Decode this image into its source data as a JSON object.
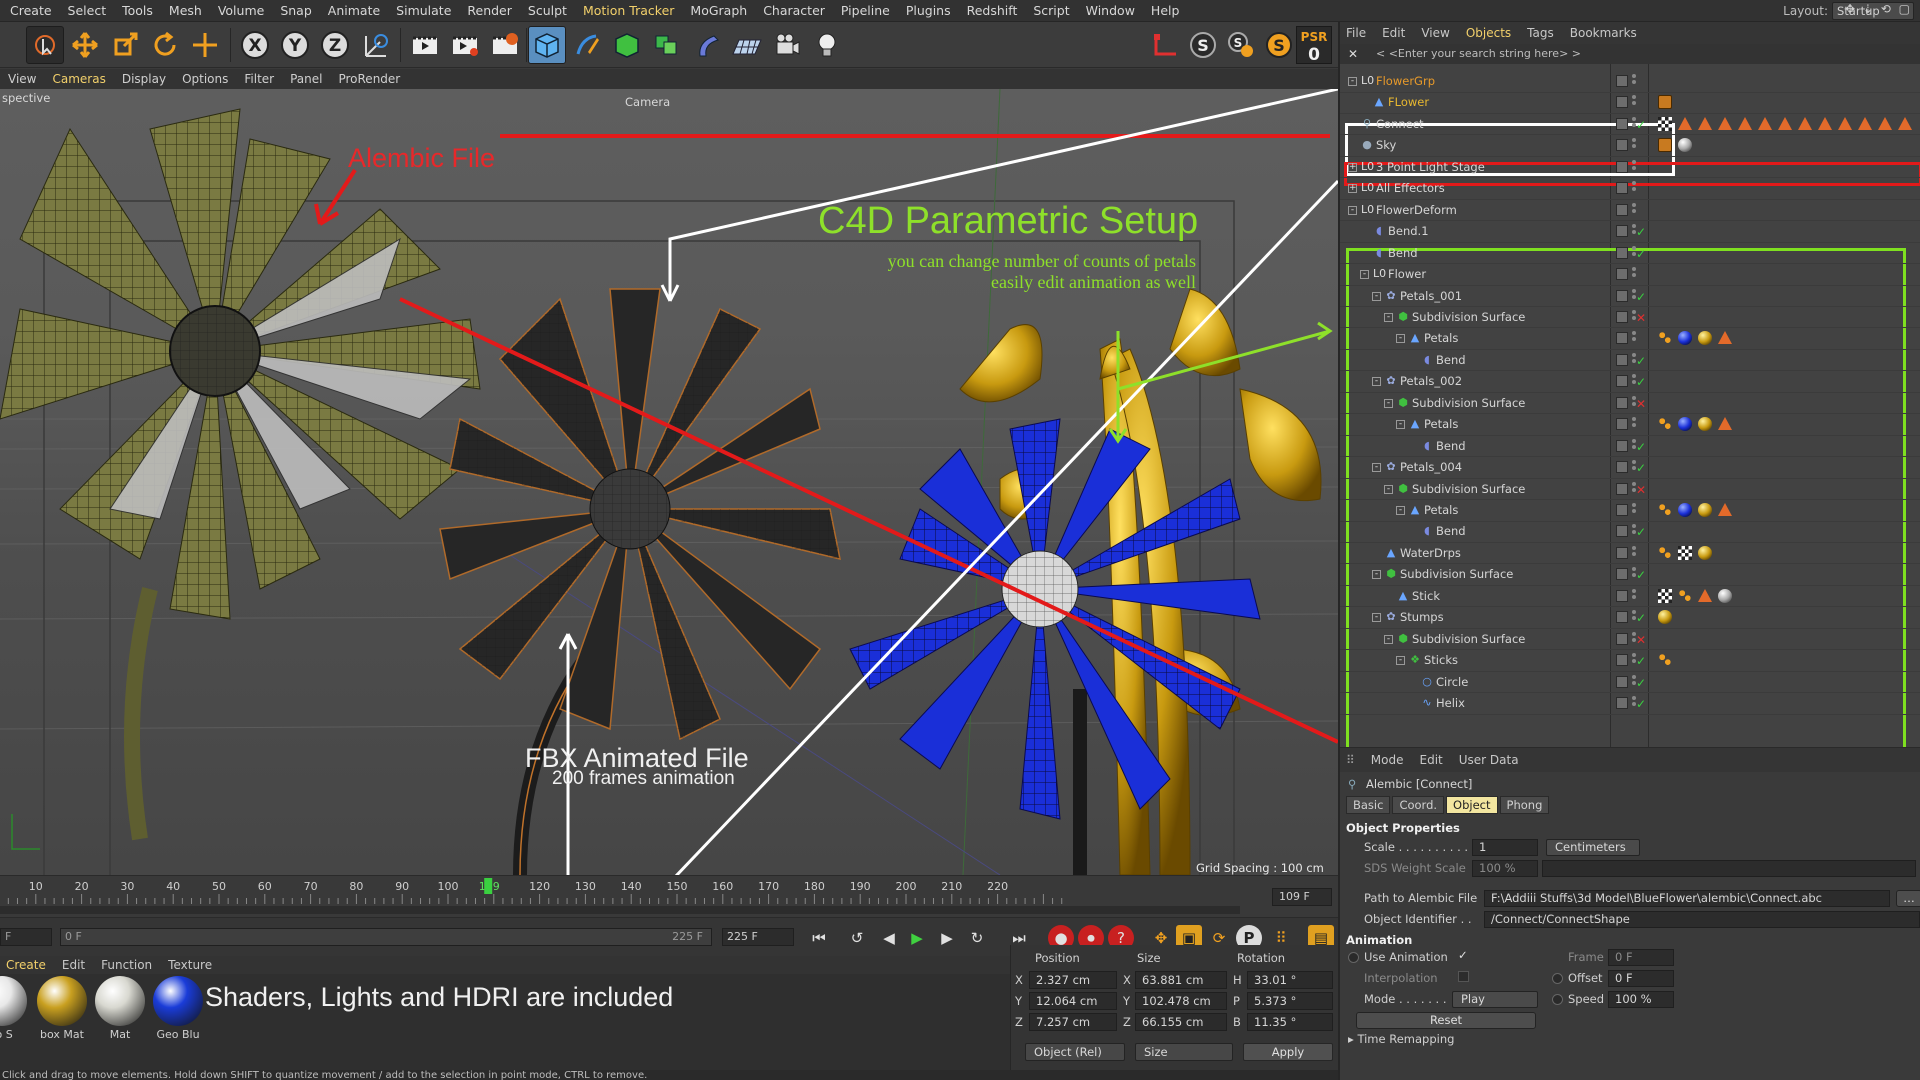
{
  "menubar": {
    "items": [
      "Create",
      "Select",
      "Tools",
      "Mesh",
      "Volume",
      "Snap",
      "Animate",
      "Simulate",
      "Render",
      "Sculpt",
      "Motion Tracker",
      "MoGraph",
      "Character",
      "Pipeline",
      "Plugins",
      "Redshift",
      "Script",
      "Window",
      "Help"
    ],
    "layout_label": "Layout:",
    "layout_value": "Startup (User)"
  },
  "toolbar": {
    "psr_label": "PSR",
    "psr_value": "0",
    "tools": [
      "live-selection",
      "move",
      "scale",
      "rotate",
      "move-snap",
      "x-axis",
      "y-axis",
      "z-axis",
      "world-coordinates",
      "render-view",
      "render-picture-viewer",
      "render-settings",
      "cube",
      "pen",
      "subdivision-surface",
      "array",
      "bend",
      "floor",
      "camera",
      "light"
    ]
  },
  "viewport": {
    "menu": [
      "View",
      "Cameras",
      "Display",
      "Options",
      "Filter",
      "Panel",
      "ProRender"
    ],
    "label_projection": "spective",
    "label_camera": "Camera",
    "grid_spacing": "Grid Spacing : 100 cm",
    "annotations": {
      "alembic": "Alembic File",
      "c4d_title": "C4D Parametric Setup",
      "c4d_sub1": "you can change number of counts of petals",
      "c4d_sub2": "easily edit animation as well",
      "fbx_title": "FBX Animated File",
      "fbx_sub": "200 frames animation"
    }
  },
  "timeline": {
    "ticks": [
      "10",
      "20",
      "30",
      "40",
      "50",
      "60",
      "70",
      "80",
      "90",
      "100",
      "109",
      "120",
      "130",
      "140",
      "150",
      "160",
      "170",
      "180",
      "190",
      "200",
      "210",
      "220"
    ],
    "current_frame": "109",
    "end_frame_display": "109 F"
  },
  "transport": {
    "start_field": "F",
    "range_start": "0 F",
    "range_end": "225 F",
    "max_field": "225 F"
  },
  "materials": {
    "menu": [
      "Create",
      "Edit",
      "Function",
      "Texture"
    ],
    "items": [
      {
        "label": "to S",
        "color": "#e8e8e8"
      },
      {
        "label": "box Mat",
        "color": "#c9a020"
      },
      {
        "label": "Mat",
        "color": "#d8d8d0"
      },
      {
        "label": "Geo Blu",
        "color": "#1a3cd8"
      }
    ],
    "annotation": "Shaders, Lights and HDRI are included"
  },
  "coords": {
    "headers": [
      "Position",
      "Size",
      "Rotation"
    ],
    "rows": [
      {
        "axis": "X",
        "pos": "2.327 cm",
        "size_axis": "X",
        "size": "63.881 cm",
        "rot_axis": "H",
        "rot": "33.01 °"
      },
      {
        "axis": "Y",
        "pos": "12.064 cm",
        "size_axis": "Y",
        "size": "102.478 cm",
        "rot_axis": "P",
        "rot": "5.373 °"
      },
      {
        "axis": "Z",
        "pos": "7.257 cm",
        "size_axis": "Z",
        "size": "66.155 cm",
        "rot_axis": "B",
        "rot": "11.35 °"
      }
    ],
    "mode": "Object (Rel)",
    "size_mode": "Size",
    "apply": "Apply"
  },
  "statusbar": "Click and drag to move elements. Hold down SHIFT to quantize movement / add to the selection in point mode, CTRL to remove.",
  "object_manager": {
    "menu": [
      "File",
      "Edit",
      "View",
      "Objects",
      "Tags",
      "Bookmarks"
    ],
    "search_placeholder": "< <Enter your search string here> >",
    "objects": [
      {
        "name": "FlowerGrp",
        "depth": 0,
        "icon": "null",
        "expand": "-",
        "color": "#e89a2a",
        "check": "",
        "tags": []
      },
      {
        "name": "FLower",
        "depth": 1,
        "icon": "poly",
        "expand": "",
        "color": "#e8b830",
        "check": "",
        "tags": [
          "orange-box"
        ]
      },
      {
        "name": "Connect",
        "depth": 0,
        "icon": "alembic",
        "expand": "",
        "color": "#d6d6d6",
        "check": "✓",
        "tags": [
          "chkr",
          "tri",
          "tri",
          "tri",
          "tri",
          "tri",
          "tri",
          "tri",
          "tri",
          "tri",
          "tri",
          "tri",
          "tri"
        ]
      },
      {
        "name": "Sky",
        "depth": 0,
        "icon": "sky",
        "expand": "",
        "color": "#d6d6d6",
        "check": "",
        "tags": [
          "orange-box",
          "ball-white"
        ]
      },
      {
        "name": "3 Point Light Stage",
        "depth": 0,
        "icon": "null",
        "expand": "+",
        "color": "#d6d6d6",
        "check": "",
        "tags": []
      },
      {
        "name": "All Effectors",
        "depth": 0,
        "icon": "null",
        "expand": "+",
        "color": "#d6d6d6",
        "check": "",
        "tags": []
      },
      {
        "name": "FlowerDeform",
        "depth": 0,
        "icon": "null",
        "expand": "-",
        "color": "#d6d6d6",
        "check": "",
        "tags": []
      },
      {
        "name": "Bend.1",
        "depth": 1,
        "icon": "deform",
        "expand": "",
        "color": "#d6d6d6",
        "check": "✓",
        "tags": []
      },
      {
        "name": "Bend",
        "depth": 1,
        "icon": "deform",
        "expand": "",
        "color": "#d6d6d6",
        "check": "✓",
        "tags": []
      },
      {
        "name": "Flower",
        "depth": 1,
        "icon": "null",
        "expand": "-",
        "color": "#d6d6d6",
        "check": "",
        "tags": []
      },
      {
        "name": "Petals_001",
        "depth": 2,
        "icon": "cloner",
        "expand": "-",
        "color": "#d6d6d6",
        "check": "✓",
        "tags": []
      },
      {
        "name": "Subdivision Surface",
        "depth": 3,
        "icon": "sds",
        "expand": "-",
        "color": "#d6d6d6",
        "check": "✕",
        "tags": []
      },
      {
        "name": "Petals",
        "depth": 4,
        "icon": "poly",
        "expand": "-",
        "color": "#d6d6d6",
        "check": "",
        "tags": [
          "dots",
          "ball-blue",
          "ball-gold",
          "tri"
        ]
      },
      {
        "name": "Bend",
        "depth": 5,
        "icon": "deform",
        "expand": "",
        "color": "#d6d6d6",
        "check": "✓",
        "tags": []
      },
      {
        "name": "Petals_002",
        "depth": 2,
        "icon": "cloner",
        "expand": "-",
        "color": "#d6d6d6",
        "check": "✓",
        "tags": []
      },
      {
        "name": "Subdivision Surface",
        "depth": 3,
        "icon": "sds",
        "expand": "-",
        "color": "#d6d6d6",
        "check": "✕",
        "tags": []
      },
      {
        "name": "Petals",
        "depth": 4,
        "icon": "poly",
        "expand": "-",
        "color": "#d6d6d6",
        "check": "",
        "tags": [
          "dots",
          "ball-blue",
          "ball-gold",
          "tri"
        ]
      },
      {
        "name": "Bend",
        "depth": 5,
        "icon": "deform",
        "expand": "",
        "color": "#d6d6d6",
        "check": "✓",
        "tags": []
      },
      {
        "name": "Petals_004",
        "depth": 2,
        "icon": "cloner",
        "expand": "-",
        "color": "#d6d6d6",
        "check": "✓",
        "tags": []
      },
      {
        "name": "Subdivision Surface",
        "depth": 3,
        "icon": "sds",
        "expand": "-",
        "color": "#d6d6d6",
        "check": "✕",
        "tags": []
      },
      {
        "name": "Petals",
        "depth": 4,
        "icon": "poly",
        "expand": "-",
        "color": "#d6d6d6",
        "check": "",
        "tags": [
          "dots",
          "ball-blue",
          "ball-gold",
          "tri"
        ]
      },
      {
        "name": "Bend",
        "depth": 5,
        "icon": "deform",
        "expand": "",
        "color": "#d6d6d6",
        "check": "✓",
        "tags": []
      },
      {
        "name": "WaterDrps",
        "depth": 2,
        "icon": "poly",
        "expand": "",
        "color": "#d6d6d6",
        "check": "",
        "tags": [
          "dots",
          "chkr",
          "ball-gold"
        ]
      },
      {
        "name": "Subdivision Surface",
        "depth": 2,
        "icon": "sds",
        "expand": "-",
        "color": "#d6d6d6",
        "check": "✓",
        "tags": []
      },
      {
        "name": "Stick",
        "depth": 3,
        "icon": "poly",
        "expand": "",
        "color": "#d6d6d6",
        "check": "",
        "tags": [
          "chkr",
          "dots",
          "tri",
          "ball-white"
        ]
      },
      {
        "name": "Stumps",
        "depth": 2,
        "icon": "cloner",
        "expand": "-",
        "color": "#d6d6d6",
        "check": "✓",
        "tags": [
          "ball-gold"
        ]
      },
      {
        "name": "Subdivision Surface",
        "depth": 3,
        "icon": "sds",
        "expand": "-",
        "color": "#d6d6d6",
        "check": "✕",
        "tags": []
      },
      {
        "name": "Sticks",
        "depth": 4,
        "icon": "sweep",
        "expand": "-",
        "color": "#d6d6d6",
        "check": "✓",
        "tags": [
          "dots"
        ]
      },
      {
        "name": "Circle",
        "depth": 5,
        "icon": "circle",
        "expand": "",
        "color": "#d6d6d6",
        "check": "✓",
        "tags": []
      },
      {
        "name": "Helix",
        "depth": 5,
        "icon": "helix",
        "expand": "",
        "color": "#d6d6d6",
        "check": "✓",
        "tags": []
      }
    ]
  },
  "attribute_manager": {
    "menu": [
      "Mode",
      "Edit",
      "User Data"
    ],
    "title": "Alembic [Connect]",
    "tabs": [
      "Basic",
      "Coord.",
      "Object",
      "Phong"
    ],
    "active_tab": "Object",
    "section_object": "Object Properties",
    "scale_label": "Scale . . . . . . . . . .",
    "scale_value": "1",
    "scale_unit": "Centimeters",
    "sds_label": "SDS Weight Scale",
    "sds_value": "100 %",
    "path_label": "Path to Alembic File",
    "path_value": "F:\\Addiii Stuffs\\3d Model\\BlueFlower\\alembic\\Connect.abc",
    "identifier_label": "Object Identifier . .",
    "identifier_value": "/Connect/ConnectShape",
    "section_animation": "Animation",
    "use_animation": "Use Animation",
    "use_animation_check": "✓",
    "interpolation": "Interpolation",
    "mode_label": "Mode . . . . . . .",
    "mode_value": "Play",
    "frame_label": "Frame",
    "frame_value": "0 F",
    "offset_label": "Offset",
    "offset_value": "0 F",
    "speed_label": "Speed",
    "speed_value": "100 %",
    "reset": "Reset",
    "time_remapping": "Time Remapping"
  }
}
